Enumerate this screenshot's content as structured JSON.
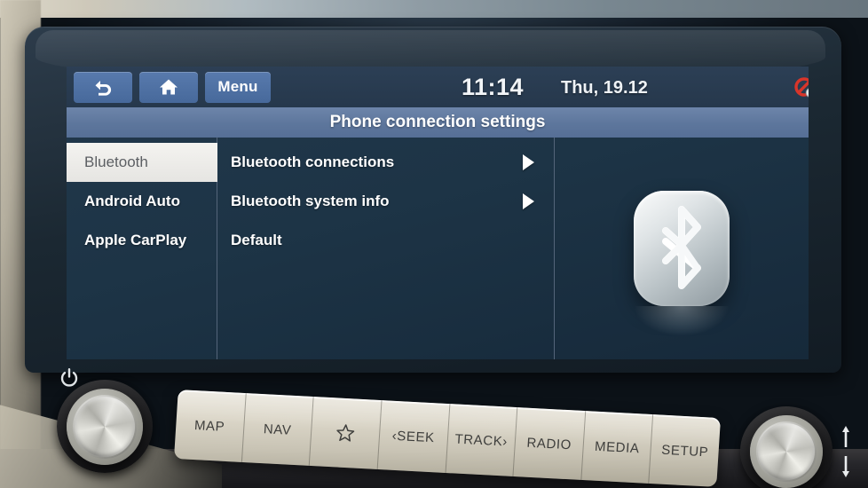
{
  "device": {
    "type": "car-infotainment-head-unit"
  },
  "header": {
    "back_label": "back-arrow",
    "home_label": "home",
    "menu_label": "Menu",
    "time": "11:14",
    "date": "Thu, 19.12",
    "status_icon": "mute-disabled-icon"
  },
  "title": "Phone connection settings",
  "sidebar": {
    "items": [
      {
        "label": "Bluetooth",
        "selected": true
      },
      {
        "label": "Android Auto",
        "selected": false
      },
      {
        "label": "Apple CarPlay",
        "selected": false
      }
    ]
  },
  "list": {
    "rows": [
      {
        "label": "Bluetooth connections",
        "has_arrow": true
      },
      {
        "label": "Bluetooth system info",
        "has_arrow": true
      },
      {
        "label": "Default",
        "has_arrow": false
      }
    ]
  },
  "logo_panel": {
    "icon": "bluetooth-logo"
  },
  "hardware": {
    "power_icon": "power-icon",
    "left_knob": "volume-knob",
    "right_knob": "tune-knob",
    "buttons": [
      {
        "label": "MAP",
        "icon": ""
      },
      {
        "label": "NAV",
        "icon": ""
      },
      {
        "label": "",
        "icon": "star-icon"
      },
      {
        "label": "‹SEEK",
        "icon": ""
      },
      {
        "label": "TRACK›",
        "icon": ""
      },
      {
        "label": "RADIO",
        "icon": ""
      },
      {
        "label": "MEDIA",
        "icon": ""
      },
      {
        "label": "SETUP",
        "icon": ""
      }
    ]
  },
  "colors": {
    "screen_bg": "#1d3446",
    "titlebar": "#5d769c",
    "header_button": "#47699b",
    "selected_tab_bg": "#efeeeb",
    "status_red": "#d8352a",
    "button_strip": "#dcd7c9"
  }
}
